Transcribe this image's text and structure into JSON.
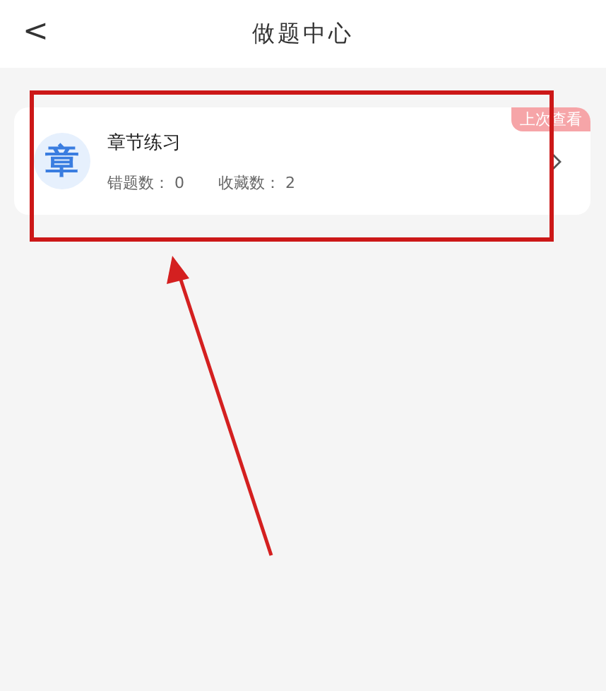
{
  "header": {
    "back_icon": "<",
    "title": "做题中心"
  },
  "items": [
    {
      "icon_char": "章",
      "title": "章节练习",
      "stats": [
        "错题数： 0",
        "收藏数： 2"
      ],
      "badge": "上次查看"
    }
  ]
}
